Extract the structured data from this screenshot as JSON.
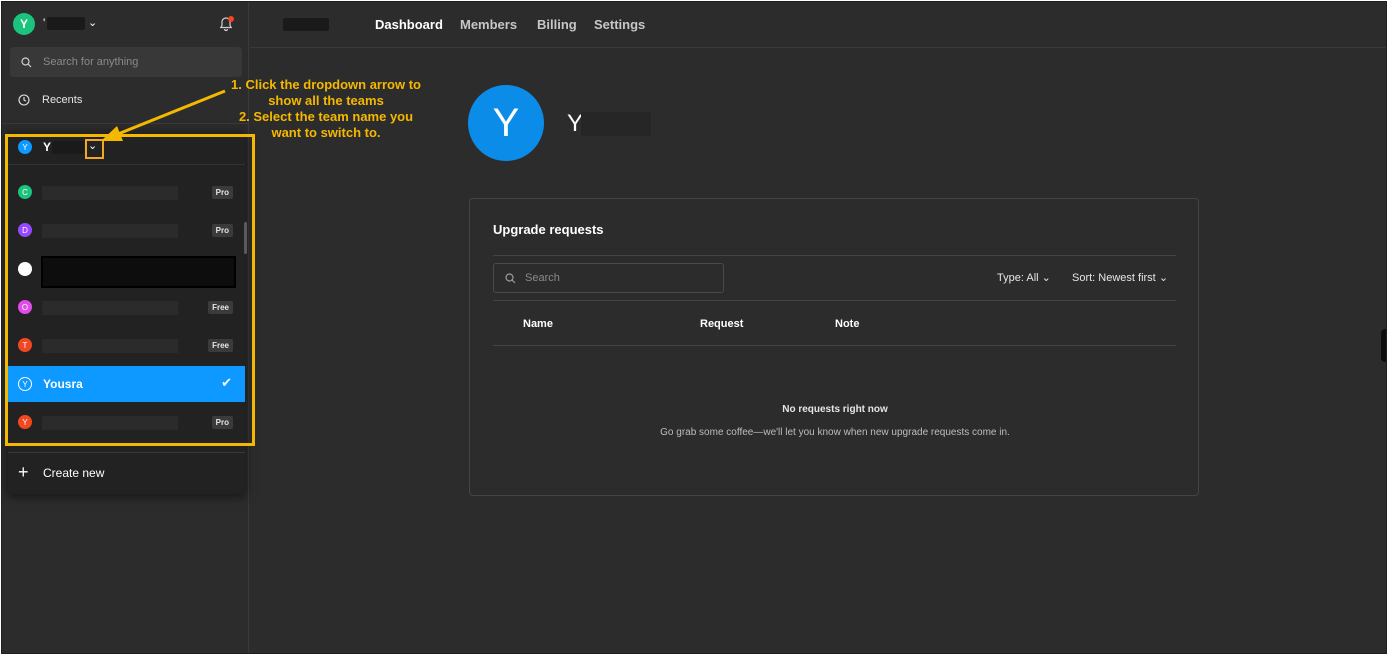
{
  "sidebar": {
    "workspace_initial": "Y",
    "workspace_name_visible": "'",
    "search_placeholder": "Search for anything",
    "recents_label": "Recents"
  },
  "dropdown": {
    "current_team_initial": "Y",
    "current_team_name_visible": "Y",
    "teams": [
      {
        "initial": "C",
        "color": "#1bc47d",
        "badge": "Pro"
      },
      {
        "initial": "D",
        "color": "#9747ff",
        "badge": "Pro"
      },
      {
        "initial": "",
        "color": "#ffffff",
        "badge": ""
      },
      {
        "initial": "O",
        "color": "#e14ce8",
        "badge": "Free"
      },
      {
        "initial": "T",
        "color": "#f24822",
        "badge": "Free"
      },
      {
        "initial": "Y",
        "color": "#0d99ff",
        "name": "Yousra",
        "selected": true
      },
      {
        "initial": "Y",
        "color": "#f24822",
        "badge": "Pro"
      }
    ],
    "create_new_label": "Create new"
  },
  "annotation": {
    "line1": "1. Click the dropdown arrow to",
    "line2": "show all the teams",
    "line3": "2. Select the team name you",
    "line4": "want to switch to.",
    "color": "#f5b800"
  },
  "nav": {
    "tabs": [
      "Dashboard",
      "Members",
      "Billing",
      "Settings"
    ],
    "active_tab": "Dashboard"
  },
  "profile": {
    "initial": "Y",
    "name_visible": "Y"
  },
  "upgrade": {
    "title": "Upgrade requests",
    "search_placeholder": "Search",
    "type_filter": "Type: All",
    "sort_filter": "Sort: Newest first",
    "columns": [
      "Name",
      "Request",
      "Note"
    ],
    "empty_title": "No requests right now",
    "empty_subtitle": "Go grab some coffee—we'll let you know when new upgrade requests come in."
  },
  "colors": {
    "accent": "#0d99ff",
    "background": "#2c2c2c",
    "highlight": "#f5b800"
  }
}
